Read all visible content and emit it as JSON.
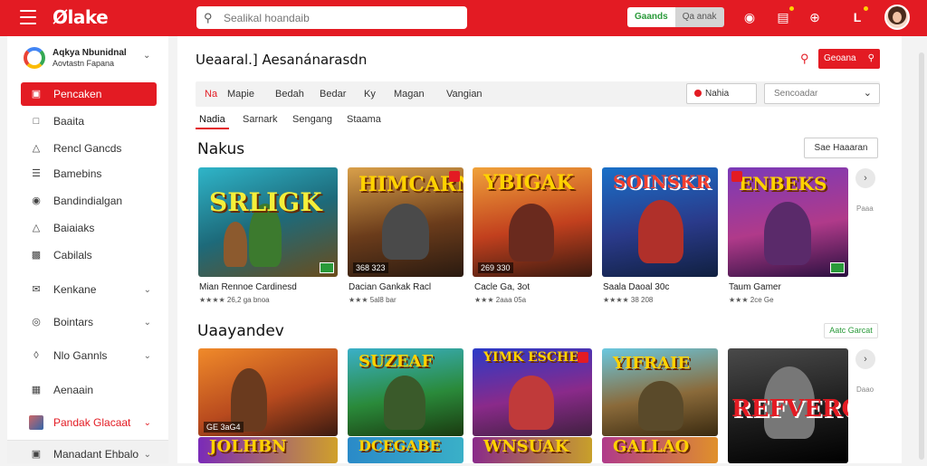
{
  "header": {
    "logo": "Ølake",
    "search_placeholder": "Sealikal hoandaib",
    "pill_green": "Gaands",
    "pill_grey": "Qa anak"
  },
  "sidebar": {
    "account_name": "Aqkya Nbunidnal",
    "account_sub": "Aovtastn Fapana",
    "items": [
      {
        "label": "Pencaken",
        "icon": "wallet-icon",
        "active": true
      },
      {
        "label": "Baaita",
        "icon": "home-icon"
      },
      {
        "label": "Rencl Gancds",
        "icon": "user-icon"
      },
      {
        "label": "Bamebins",
        "icon": "list-icon"
      },
      {
        "label": "Bandindialgan",
        "icon": "people-icon"
      },
      {
        "label": "Baiaiaks",
        "icon": "user-icon"
      },
      {
        "label": "Cabilals",
        "icon": "card-icon"
      },
      {
        "label": "Kenkane",
        "icon": "mail-icon"
      },
      {
        "label": "Bointars",
        "icon": "target-icon"
      },
      {
        "label": "Nlo Gannls",
        "icon": "chat-icon"
      },
      {
        "label": "Aenaain",
        "icon": "grid-icon"
      },
      {
        "label": "Pandak Glacaat",
        "icon": "thumbnail-icon"
      },
      {
        "label": "Manadant Ehbalo",
        "icon": "image-icon"
      }
    ]
  },
  "main": {
    "title": "Ueaaral.] Aesanánarasdn",
    "header_button": "Geoana",
    "filters": [
      "Na",
      "Mapie",
      "Bedah",
      "Bedar",
      "Ky",
      "Magan",
      "Vangian"
    ],
    "filter_button": "Nahia",
    "filter_select": "Sencoadar",
    "tabs": [
      "Nadia",
      "Sarnark",
      "Sengang",
      "Staama"
    ],
    "section1": {
      "title": "Nakus",
      "see_all": "Sae Haaaran",
      "side_label": "Paaa"
    },
    "section2": {
      "title": "Uaayandev",
      "view_all": "Aatc Garcat",
      "side_label": "Daao"
    },
    "row1": [
      {
        "art": "SRLIGK",
        "price": "",
        "title": "Mian Rennoe Cardinesd",
        "rating": "★★★★ 26,2 ga bnoa"
      },
      {
        "art": "HIMCARN",
        "price": "368 323",
        "title": "Dacian Gankak Racl",
        "rating": "★★★ 5al8 bar"
      },
      {
        "art": "YBIGAK",
        "price": "269 330",
        "title": "Cacle Ga, 3ot",
        "rating": "★★★ 2aaa 05a"
      },
      {
        "art": "SOINSKR",
        "price": "",
        "title": "Saala Daoal 30c",
        "rating": "★★★★ 38 208"
      },
      {
        "art": "ENBEKS",
        "price": "",
        "title": "Taum Gamer",
        "rating": "★★★ 2ce Ge"
      }
    ],
    "row2": [
      {
        "art": "",
        "price": "GE 3aG4",
        "title": "",
        "rating": ""
      },
      {
        "art": "SUZEAF",
        "price": "",
        "title": "",
        "rating": ""
      },
      {
        "art": "YIMK ESCHE",
        "price": "",
        "title": "",
        "rating": ""
      },
      {
        "art": "YIFRAIE",
        "price": "",
        "title": "",
        "rating": ""
      },
      {
        "art": "REFVERCA",
        "price": "",
        "title": "",
        "rating": ""
      }
    ],
    "row3": [
      {
        "art": "JOLHBN"
      },
      {
        "art": "DCEGABE"
      },
      {
        "art": "WNSUAK"
      },
      {
        "art": "GALLAO"
      },
      {
        "art": ""
      }
    ]
  },
  "colors": {
    "brand": "#e31b23",
    "accent_green": "#2a9a3a"
  }
}
